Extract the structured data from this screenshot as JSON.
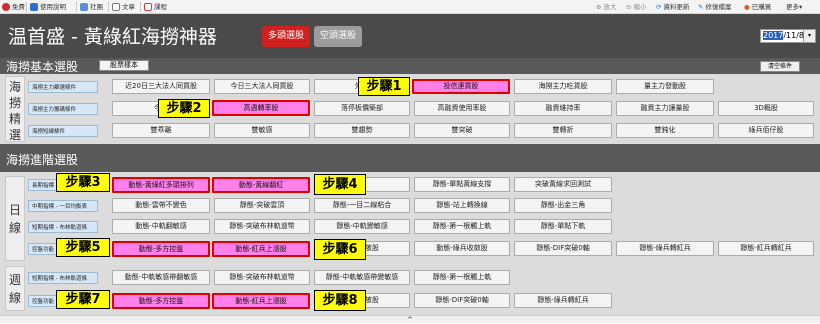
{
  "toolbar": {
    "left_items": [
      {
        "label": "免費",
        "icon": "logo-icon",
        "color": "#d22b2b"
      },
      {
        "label": "使用說明",
        "icon": "help-icon",
        "color": "#2d6fd6"
      },
      {
        "label": "社團",
        "icon": "community-icon",
        "color": "#5a8fd8"
      },
      {
        "label": "文章",
        "icon": "article-icon",
        "color": "#777777"
      },
      {
        "label": "課程",
        "icon": "course-icon",
        "color": "#d43c3c"
      }
    ],
    "right_items": [
      {
        "label": "放大",
        "icon": "zoom-in-icon"
      },
      {
        "label": "縮小",
        "icon": "zoom-out-icon"
      },
      {
        "label": "資料更新",
        "icon": "refresh-icon"
      },
      {
        "label": "修復檔案",
        "icon": "repair-icon"
      },
      {
        "label": "已購買",
        "icon": "purchased-icon"
      },
      {
        "label": "更多"
      }
    ]
  },
  "header": {
    "title": "温首盛 - 黃綠紅海撈神器",
    "bull_button": "多頭選股",
    "bear_button": "空頭選股",
    "date_year": "2017",
    "date_rest": "/11/8",
    "bull_color": "#d22020",
    "bear_color": "#9c9c9c"
  },
  "basic": {
    "title": "海撈基本選股",
    "sample_button": "股票樣本",
    "clear_button": "清空條件",
    "side_label": [
      "海",
      "撈",
      "精",
      "選"
    ],
    "rows": [
      {
        "label": "海撈主力篩選條件",
        "buttons": [
          "近20日三大法人同買股",
          "今日三大法人同買股",
          "外資",
          "投信連買股",
          "海撈主力吃貨股",
          "量主力發動股"
        ]
      },
      {
        "label": "海撈主力籌碼條件",
        "buttons": [
          "今日",
          "高週轉率股",
          "落停板價築部",
          "高融資使用率股",
          "融資維持率",
          "融資主力讓量股",
          "3D概股"
        ]
      },
      {
        "label": "海撈短線條件",
        "buttons": [
          "雙乖離",
          "雙敏感",
          "雙趨勢",
          "雙突破",
          "雙轉折",
          "雙鈍化",
          "綠兵佰仔股"
        ]
      }
    ]
  },
  "advanced": {
    "title": "海撈進階選股",
    "day_label": [
      "日",
      "線"
    ],
    "week_label": [
      "週",
      "線"
    ],
    "day_rows": [
      {
        "label": "長期指標",
        "buttons": [
          "動態-黃綠紅多頭排列",
          "動態-黃線翻紅",
          "",
          "靜態-單點黃線支撐",
          "突破黃線求回測試"
        ]
      },
      {
        "label": "中期指標 - 一目均衡表",
        "buttons": [
          "動態-雲帶不變色",
          "靜態-突破雲頂",
          "靜態-一目二線粘合",
          "靜態-站上轉換線",
          "靜態-出金三角"
        ]
      },
      {
        "label": "短期指標 - 布林軌道條",
        "buttons": [
          "動態-中軌翻敏感",
          "靜態-突破布林軌道幣",
          "靜態-中軌變敏感",
          "靜態-第一根觸上軌",
          "靜態-單點下軌"
        ]
      },
      {
        "label": "控盤功能",
        "buttons": [
          "動態-多方控盤",
          "動態-紅兵上漲股",
          "收敂股",
          "動態-綠兵收斂股",
          "靜態-DIF突破0軸",
          "靜態-綠兵轉紅兵",
          "靜態-紅兵轉紅兵"
        ]
      }
    ],
    "week_rows": [
      {
        "label": "短期指標 - 布林軌道條",
        "buttons": [
          "動態-中軌敏感帶翻敏感",
          "靜態-突破布林軌道幣",
          "靜態-中軌敏感帶變敏感",
          "靜態-第一根觸上軌"
        ]
      },
      {
        "label": "控盤功能",
        "buttons": [
          "動態-多方控盤",
          "動態-紅兵上漲股",
          "收敂股",
          "靜態-DIF突破0軸",
          "靜態-綠兵轉紅兵"
        ]
      }
    ]
  },
  "steps": [
    "步驟1",
    "步驟2",
    "步驟3",
    "步驟4",
    "步驟5",
    "步驟6",
    "步驟7",
    "步驟8"
  ],
  "bottom": {
    "arrow": "^"
  }
}
